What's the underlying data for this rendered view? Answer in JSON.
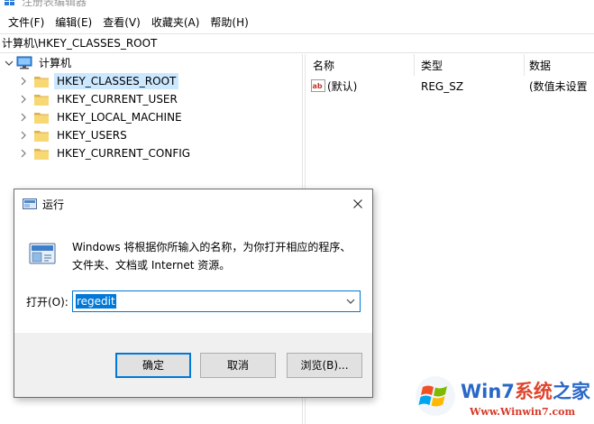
{
  "window": {
    "title": "注册表编辑器"
  },
  "menu": [
    {
      "label": "文件(F)"
    },
    {
      "label": "编辑(E)"
    },
    {
      "label": "查看(V)"
    },
    {
      "label": "收藏夹(A)"
    },
    {
      "label": "帮助(H)"
    }
  ],
  "address": "计算机\\HKEY_CLASSES_ROOT",
  "tree": {
    "root": "计算机",
    "children": [
      {
        "label": "HKEY_CLASSES_ROOT",
        "selected": true
      },
      {
        "label": "HKEY_CURRENT_USER"
      },
      {
        "label": "HKEY_LOCAL_MACHINE"
      },
      {
        "label": "HKEY_USERS"
      },
      {
        "label": "HKEY_CURRENT_CONFIG"
      }
    ]
  },
  "list": {
    "columns": [
      "名称",
      "类型",
      "数据"
    ],
    "rows": [
      {
        "name": "(默认)",
        "type": "REG_SZ",
        "data": "(数值未设置"
      }
    ]
  },
  "run_dialog": {
    "title": "运行",
    "description": "Windows 将根据你所输入的名称，为你打开相应的程序、文件夹、文档或 Internet 资源。",
    "open_label": "打开(O):",
    "input_value": "regedit",
    "buttons": {
      "ok": "确定",
      "cancel": "取消",
      "browse": "浏览(B)..."
    }
  },
  "watermark": {
    "brand_part1": "Win7",
    "brand_part2": "系统",
    "brand_part3": "之家",
    "url": "Www.Winwin7.com"
  },
  "colors": {
    "selection": "#cce8ff",
    "accent": "#0078d7",
    "folder": "#f8d775"
  }
}
